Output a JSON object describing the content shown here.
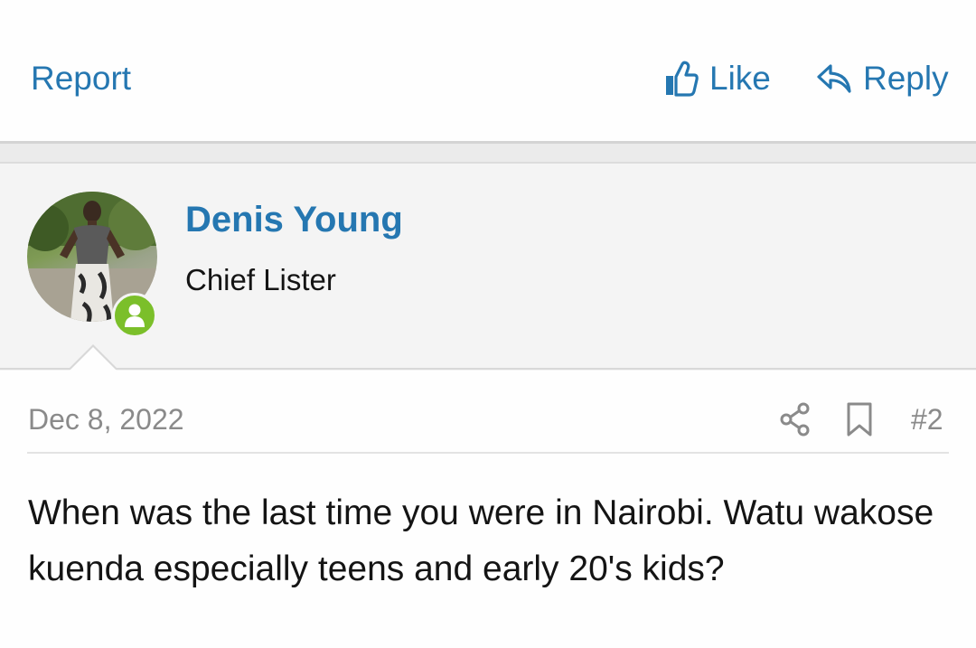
{
  "actions": {
    "report": "Report",
    "like": "Like",
    "reply": "Reply"
  },
  "user": {
    "name": "Denis Young",
    "title": "Chief Lister"
  },
  "post": {
    "date": "Dec 8, 2022",
    "number": "#2",
    "body": "When was the last time you were in Nairobi. Watu wakose kuenda especially teens and early 20's kids?"
  },
  "icons": {
    "like": "thumbs-up-icon",
    "reply": "reply-arrow-icon",
    "status": "user-online-icon",
    "share": "share-icon",
    "bookmark": "bookmark-icon"
  },
  "colors": {
    "link": "#2577b1",
    "online": "#7bbf2a",
    "muted": "#8a8a8a",
    "header_bg": "#f4f4f4"
  }
}
